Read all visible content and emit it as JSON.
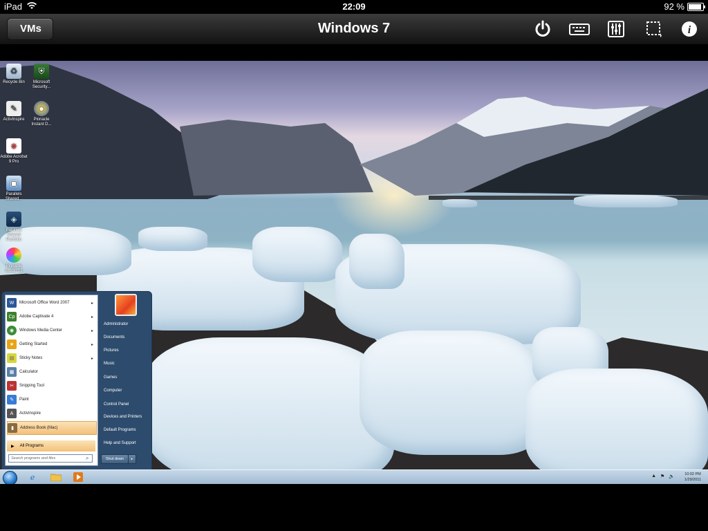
{
  "status_bar": {
    "device": "iPad",
    "time": "22:09",
    "battery": "92 %"
  },
  "navbar": {
    "back_label": "VMs",
    "title": "Windows 7",
    "icons": [
      "power-icon",
      "keyboard-icon",
      "mixer-icon",
      "selection-icon",
      "info-icon"
    ]
  },
  "desktop_icons": [
    {
      "label": "Recycle Bin",
      "icon": "recycle-bin-icon"
    },
    {
      "label": "Microsoft Security...",
      "icon": "security-icon"
    },
    {
      "label": "ActivInspire",
      "icon": "activinspire-icon"
    },
    {
      "label": "Pinnacle Instant D...",
      "icon": "pinnacle-icon"
    },
    {
      "label": "Adobe Acrobat 9 Pro",
      "icon": "acrobat-icon"
    },
    {
      "label": "Parallels Shared...",
      "icon": "parallels-icon"
    },
    {
      "label": "Parallels Shared Portfolio",
      "icon": "portfolio-icon"
    },
    {
      "label": "Pinnacle Studio 12",
      "icon": "studio-icon"
    }
  ],
  "start_menu": {
    "programs": [
      {
        "label": "Microsoft Office Word 2007",
        "has_arrow": true,
        "color": "#2b5797",
        "glyph": "W"
      },
      {
        "label": "Adobe Captivate 4",
        "has_arrow": true,
        "color": "#3f7f2f",
        "glyph": "Cp"
      },
      {
        "label": "Windows Media Center",
        "has_arrow": true,
        "color": "#3d8b37",
        "glyph": "◉"
      },
      {
        "label": "Getting Started",
        "has_arrow": true,
        "color": "#e8a419",
        "glyph": "★"
      },
      {
        "label": "Sticky Notes",
        "has_arrow": true,
        "color": "#d6d640",
        "glyph": "▤"
      },
      {
        "label": "Calculator",
        "has_arrow": false,
        "color": "#5a7fa8",
        "glyph": "▦"
      },
      {
        "label": "Snipping Tool",
        "has_arrow": false,
        "color": "#b33",
        "glyph": "✂"
      },
      {
        "label": "Paint",
        "has_arrow": false,
        "color": "#3a7bd5",
        "glyph": "✎"
      },
      {
        "label": "ActivInspire",
        "has_arrow": false,
        "color": "#555",
        "glyph": "A"
      },
      {
        "label": "Address Book (Mac)",
        "has_arrow": false,
        "color": "#8a6a40",
        "glyph": "▮",
        "highlighted": true
      }
    ],
    "all_programs": "All Programs",
    "search_placeholder": "Search programs and files",
    "places": [
      "Administrator",
      "Documents",
      "Pictures",
      "Music",
      "Games",
      "Computer",
      "Control Panel",
      "Devices and Printers",
      "Default Programs",
      "Help and Support"
    ],
    "shutdown": "Shut down"
  },
  "taskbar": {
    "pinned": [
      "internet-explorer-icon",
      "explorer-folder-icon",
      "media-player-icon"
    ],
    "tray_icons": [
      "▲",
      "⚑",
      "🔈"
    ],
    "clock_time": "10:02 PM",
    "clock_date": "1/29/2011"
  }
}
